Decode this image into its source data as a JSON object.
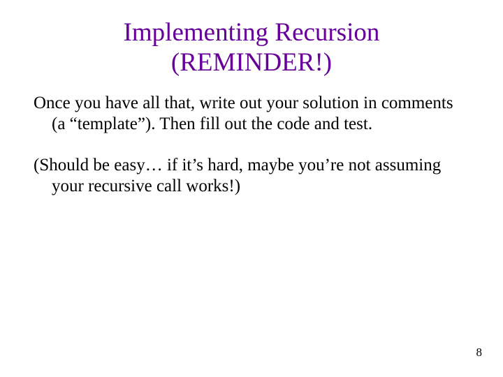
{
  "slide": {
    "title_line1": "Implementing Recursion",
    "title_line2": "(REMINDER!)",
    "paragraph1": "Once you have all that, write out your solution in comments (a “template”). Then fill out the code and test.",
    "paragraph2": "(Should be easy… if it’s hard, maybe you’re not assuming your recursive call works!)",
    "page_number": "8"
  }
}
